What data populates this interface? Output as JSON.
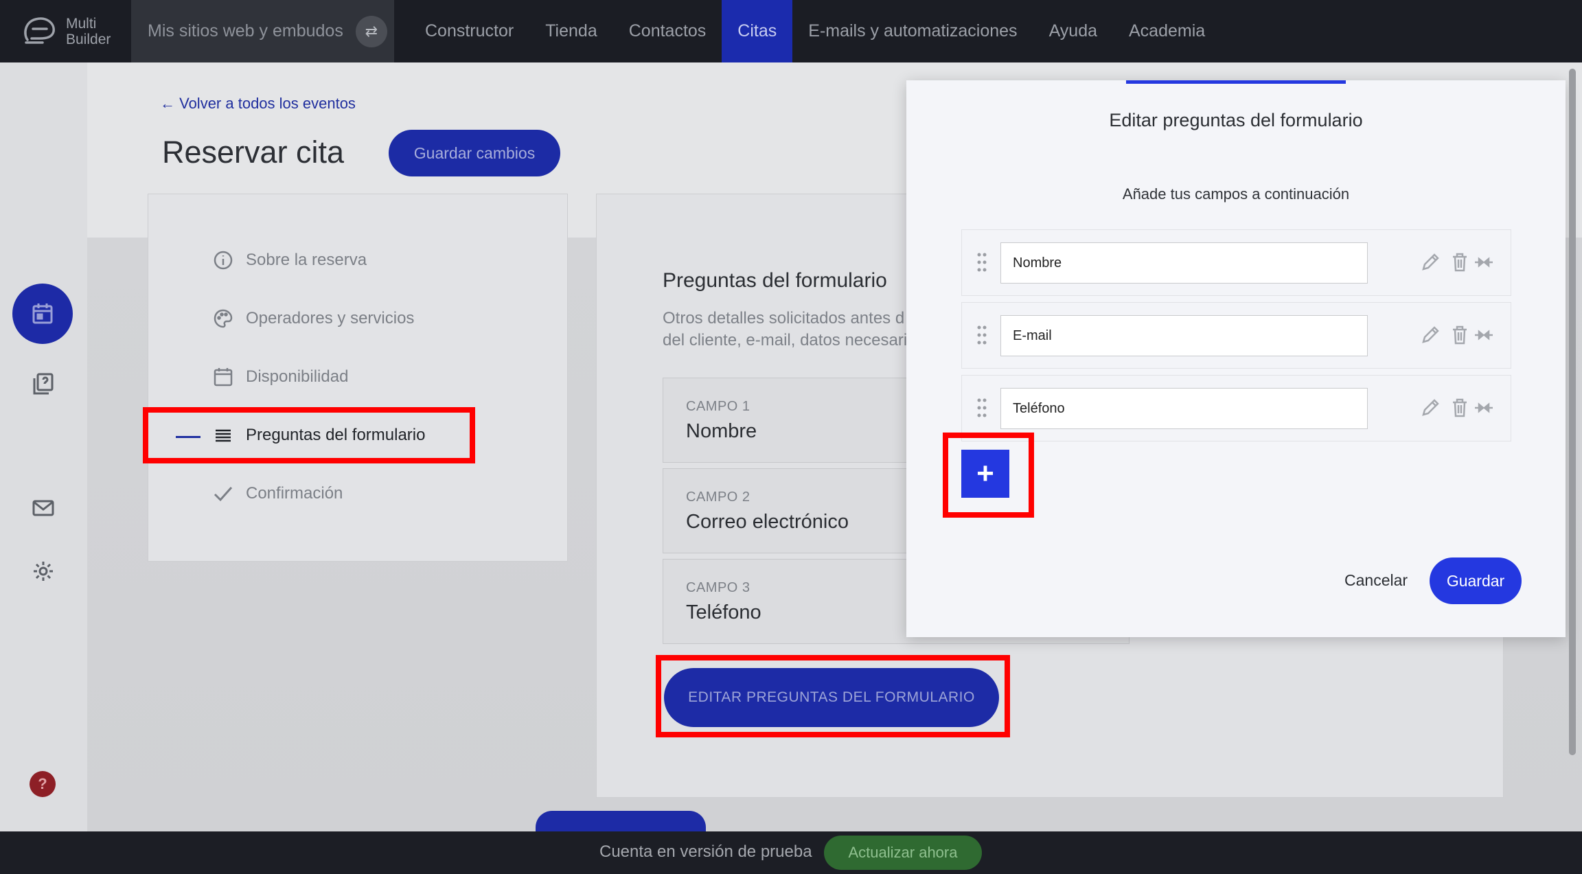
{
  "brand": {
    "line1": "Multi",
    "line2": "Builder"
  },
  "nav": {
    "sites": "Mis sitios web y embudos",
    "items": [
      "Constructor",
      "Tienda",
      "Contactos",
      "Citas",
      "E-mails y automatizaciones",
      "Ayuda",
      "Academia"
    ],
    "active": "Citas"
  },
  "rail": {
    "icons": [
      "contacts-icon",
      "pages-icon",
      "calendar-icon",
      "mail-icon",
      "settings-icon"
    ],
    "help": "?"
  },
  "page": {
    "back_link": "← Volver a todos los eventos",
    "title": "Reservar cita",
    "save_changes": "Guardar cambios"
  },
  "steps": [
    {
      "label": "Sobre la reserva",
      "icon": "info-icon"
    },
    {
      "label": "Operadores y servicios",
      "icon": "palette-icon"
    },
    {
      "label": "Disponibilidad",
      "icon": "calendar-icon"
    },
    {
      "label": "Preguntas del formulario",
      "icon": "list-icon"
    },
    {
      "label": "Confirmación",
      "icon": "check-icon"
    }
  ],
  "form_section": {
    "title": "Preguntas del formulario",
    "desc_line1": "Otros detalles solicitados antes d",
    "desc_line2": "del cliente, e-mail, datos necesari",
    "fields": [
      {
        "label": "CAMPO 1",
        "value": "Nombre"
      },
      {
        "label": "CAMPO 2",
        "value": "Correo electrónico"
      },
      {
        "label": "CAMPO 3",
        "value": "Teléfono"
      }
    ],
    "edit_button": "EDITAR PREGUNTAS DEL FORMULARIO"
  },
  "trial": {
    "text": "Cuenta en versión de prueba",
    "upgrade": "Actualizar ahora"
  },
  "modal": {
    "title": "Editar preguntas del formulario",
    "subtitle": "Añade tus campos a continuación",
    "rows": [
      "Nombre",
      "E-mail",
      "Teléfono"
    ],
    "add": "+",
    "cancel": "Cancelar",
    "save": "Guardar"
  },
  "colors": {
    "accent": "#2438e0",
    "highlight": "#ff0000",
    "nav_bg": "#1b1d24"
  }
}
